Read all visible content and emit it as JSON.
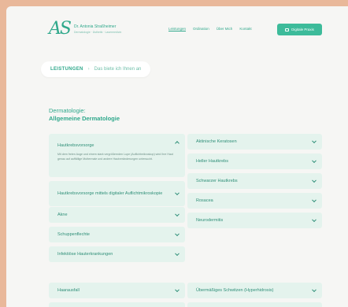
{
  "logo": {
    "mark": "AS",
    "name": "Dr. Antonia Straßheimer",
    "subtitle": "Dermatologie · Ästhetik · Lasermedizin"
  },
  "nav": {
    "items": [
      "Leistungen",
      "Ordination",
      "Über Mich",
      "Kontakt"
    ],
    "active_index": 0
  },
  "cta": {
    "label": "Digitale Praxis",
    "icon": "calendar-icon"
  },
  "breadcrumb": {
    "section": "LEISTUNGEN",
    "separator": "›",
    "subtitle": "Das biete ich Ihnen an"
  },
  "section": {
    "label": "Dermatologie:",
    "title": "Allgemeine Dermatologie"
  },
  "accordions_left": [
    {
      "label": "Hautkrebsvorsorge",
      "open": true,
      "body": "Mit dem freien Auge und einem stark vergrößernden Lupe (Auflichtmikroskop) wird Ihre Haut genau auf auffällige Muttermale und andere Hautveränderungen untersucht."
    },
    {
      "label": "Hautkrebsvorsorge mittels digitaler Auflichtmikroskopie",
      "open": false
    },
    {
      "label": "Akne",
      "open": false
    },
    {
      "label": "Schuppenflechte",
      "open": false
    },
    {
      "label": "Infektiöse Hauterkrankungen",
      "open": false
    }
  ],
  "accordions_right": [
    {
      "label": "Aktinische Keratosen",
      "open": false
    },
    {
      "label": "Heller Hautkrebs",
      "open": false
    },
    {
      "label": "Schwarzer Hautkrebs",
      "open": false
    },
    {
      "label": "Rosacea",
      "open": false
    },
    {
      "label": "Neurodermitis",
      "open": false
    }
  ],
  "accordions_bottom": [
    {
      "label": "Haarausfall",
      "open": false
    },
    {
      "label": "Übermäßiges Schwitzen (Hyperhidrosis)",
      "open": false
    }
  ],
  "colors": {
    "accent": "#2fa88b",
    "panel": "#e4f3ed",
    "frame": "#e9b89a",
    "page": "#f6f6f4"
  }
}
